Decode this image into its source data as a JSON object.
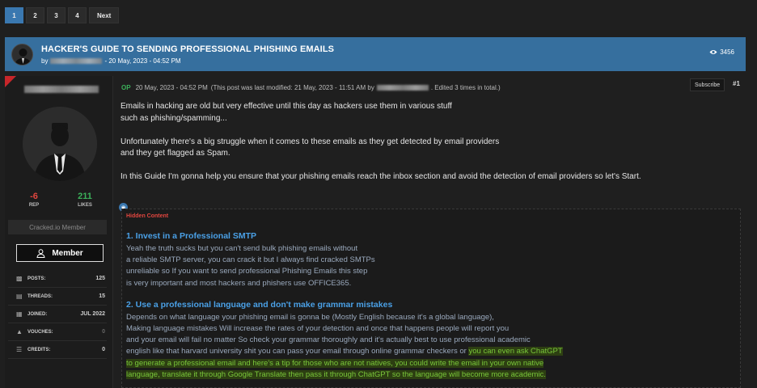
{
  "pagination": {
    "pages": [
      "1",
      "2",
      "3",
      "4"
    ],
    "next_label": "Next",
    "active": "1"
  },
  "thread": {
    "title": "HACKER'S GUIDE TO SENDING PROFESSIONAL PHISHING EMAILS",
    "by_label": "by",
    "date": "- 20 May, 2023 - 04:52 PM",
    "views": "3456"
  },
  "user": {
    "rep_value": "-6",
    "rep_label": "REP",
    "likes_value": "211",
    "likes_label": "LIKES",
    "rank": "Cracked.io Member",
    "member_label": "Member",
    "stats": [
      {
        "icon": "comments-icon",
        "key": "POSTS:",
        "value": "125"
      },
      {
        "icon": "threads-icon",
        "key": "THREADS:",
        "value": "15"
      },
      {
        "icon": "calendar-icon",
        "key": "JOINED:",
        "value": "JUL 2022"
      },
      {
        "icon": "thumbs-up-icon",
        "key": "VOUCHES:",
        "value": "0"
      },
      {
        "icon": "credits-icon",
        "key": "CREDITS:",
        "value": "0"
      }
    ]
  },
  "post": {
    "op_label": "OP",
    "date": "20 May, 2023 - 04:52 PM",
    "modified_prefix": "(This post was last modified: 21 May, 2023 - 11:51 AM by",
    "modified_suffix": ". Edited 3 times in total.)",
    "subscribe_label": "Subscribe",
    "number": "#1",
    "paragraphs": [
      [
        "Emails in hacking are old but very effective until this day as hackers use them in various stuff",
        "such as phishing/spamming..."
      ],
      [
        "Unfortunately there's a big struggle when it comes to these emails as they get detected by email providers",
        "and they get flagged as Spam."
      ],
      [
        "In this Guide I'm gonna help you ensure that your phishing emails reach the inbox section and avoid the detection of email providers so let's Start."
      ]
    ]
  },
  "hidden": {
    "label": "Hidden Content",
    "section1": {
      "title": "1. Invest in a Professional SMTP",
      "lines": [
        "Yeah the truth sucks but you can't send bulk phishing emails without",
        "a reliable SMTP server, you can crack it but I always find cracked SMTPs",
        "unreliable so If you want to send professional Phishing Emails this step",
        "is very important and most hackers and phishers use OFFICE365."
      ]
    },
    "section2": {
      "title": "2. Use a professional language and don't make grammar mistakes",
      "lines": [
        "Depends on what language your phishing email is gonna be (Mostly English because it's a global language),",
        "Making language mistakes Will increase the rates of your detection and once that happens people will report you",
        "and your email will fail no matter So check your grammar thoroughly and it's actually best to use professional academic"
      ],
      "line4_plain": "english like that harvard university shit you can pass your email through online grammar checkers or ",
      "line4_highlight": "you can even ask ChatGPT",
      "highlight_lines": [
        "to generate a professional email and here's a tip for those who are not natives, you could write the email in your own native",
        "language, translate it through Google Translate then pass it through ChatGPT so the language will become more academic."
      ]
    }
  },
  "colors": {
    "header_blue": "#366f9e",
    "rep_red": "#e2463f",
    "likes_green": "#3bb05a",
    "section_title_blue": "#4aa0e6",
    "highlight_green": "#79c63a"
  }
}
